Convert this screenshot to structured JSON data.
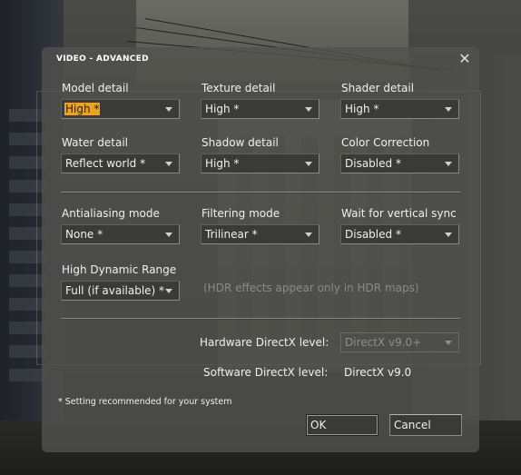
{
  "dialog": {
    "title": "VIDEO - ADVANCED",
    "close_icon": "close-icon"
  },
  "settings": {
    "model_detail": {
      "label": "Model detail",
      "value": "High *"
    },
    "texture_detail": {
      "label": "Texture detail",
      "value": "High *"
    },
    "shader_detail": {
      "label": "Shader detail",
      "value": "High *"
    },
    "water_detail": {
      "label": "Water detail",
      "value": "Reflect world *"
    },
    "shadow_detail": {
      "label": "Shadow detail",
      "value": "High *"
    },
    "color_correction": {
      "label": "Color Correction",
      "value": "Disabled *"
    },
    "antialiasing_mode": {
      "label": "Antialiasing mode",
      "value": "None *"
    },
    "filtering_mode": {
      "label": "Filtering mode",
      "value": "Trilinear *"
    },
    "vsync": {
      "label": "Wait for vertical sync",
      "value": "Disabled *"
    },
    "hdr": {
      "label": "High Dynamic Range",
      "value": "Full (if available) *"
    },
    "hdr_note": "(HDR effects appear only in HDR maps)"
  },
  "directx": {
    "hardware_label": "Hardware DirectX level:",
    "hardware_value": "DirectX v9.0+",
    "software_label": "Software DirectX level:",
    "software_value": "DirectX v9.0"
  },
  "footnote": "* Setting recommended for your system",
  "buttons": {
    "ok": "OK",
    "cancel": "Cancel"
  },
  "colors": {
    "selection": "#f1a21d",
    "dialog_bg": "#52524e"
  }
}
